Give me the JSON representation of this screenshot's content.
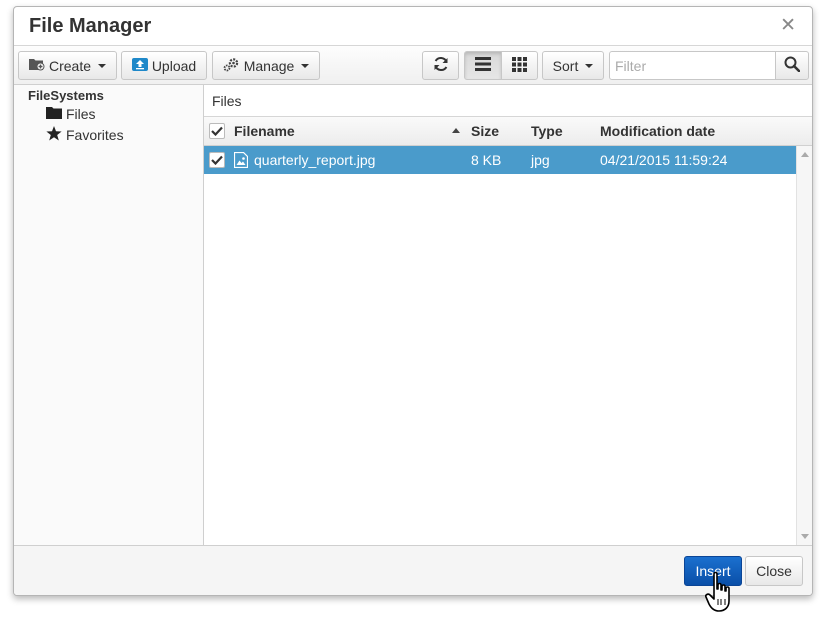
{
  "window": {
    "title": "File Manager",
    "close_icon": "close-icon"
  },
  "toolbar": {
    "create_label": "Create",
    "upload_label": "Upload",
    "manage_label": "Manage",
    "refresh_icon": "refresh-icon",
    "list_view_icon": "list-view-icon",
    "grid_view_icon": "grid-view-icon",
    "sort_label": "Sort",
    "filter_placeholder": "Filter",
    "filter_value": "",
    "search_icon": "search-icon"
  },
  "sidebar": {
    "root_label": "FileSystems",
    "items": [
      {
        "label": "Files",
        "icon": "folder-icon"
      },
      {
        "label": "Favorites",
        "icon": "star-icon"
      }
    ]
  },
  "main": {
    "breadcrumb": "Files",
    "columns": [
      "Filename",
      "Size",
      "Type",
      "Modification date"
    ],
    "sort_column": "Filename",
    "sort_direction": "ascending",
    "rows": [
      {
        "filename": "quarterly_report.jpg",
        "size": "8 KB",
        "type": "jpg",
        "modified": "04/21/2015 11:59:24",
        "selected": true,
        "icon": "image-file-icon"
      }
    ]
  },
  "footer": {
    "insert_label": "Insert",
    "close_label": "Close"
  },
  "colors": {
    "selection": "#4a9bcb",
    "primary_button": "#1160be"
  }
}
